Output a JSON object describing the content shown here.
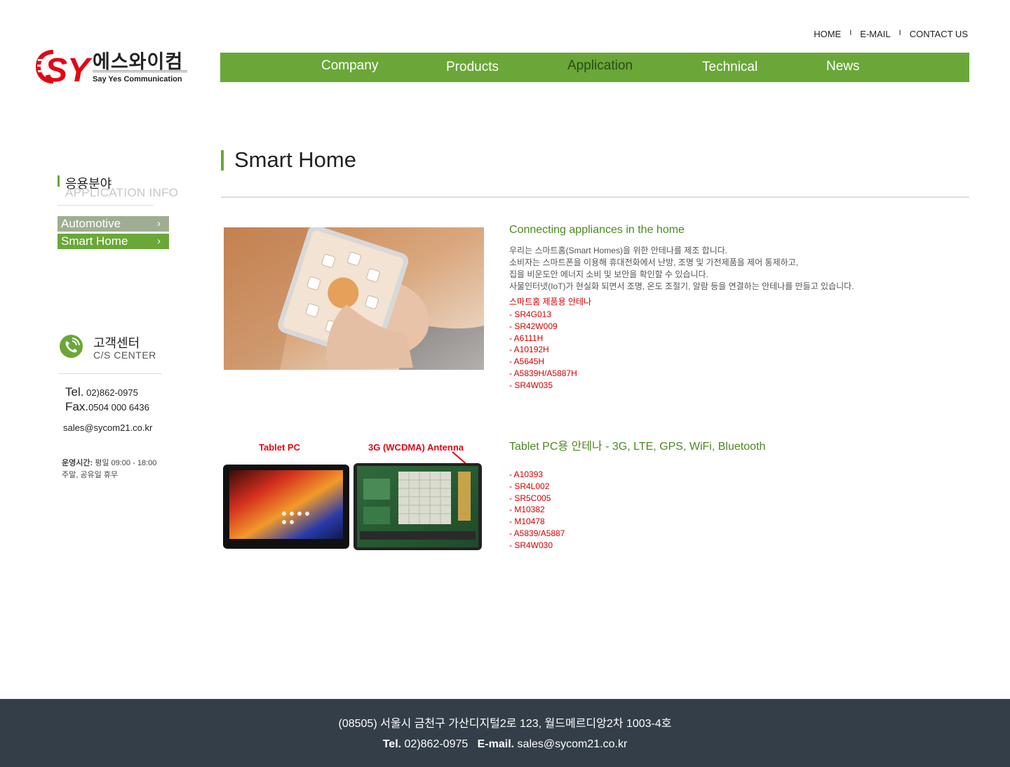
{
  "top_links": [
    "HOME",
    "E-MAIL",
    "CONTACT US"
  ],
  "top_link_separator": "I",
  "logo": {
    "mark": "SY",
    "name_ko": "에스와이컴",
    "name_en": "Say Yes Communication"
  },
  "nav": {
    "items": [
      "Company",
      "Products",
      "Application",
      "Technical",
      "News"
    ],
    "active": "Application"
  },
  "sidebar": {
    "title_ko": "응용분야",
    "title_en": "APPLICATION INFO",
    "menu": [
      {
        "label": "Automotive",
        "active": false
      },
      {
        "label": "Smart Home",
        "active": true
      }
    ],
    "cs_title_ko": "고객센터",
    "cs_title_en": "C/S CENTER",
    "tel_label": "Tel.",
    "tel": "02)862-0975",
    "fax_label": "Fax.",
    "fax": "0504 000 6436",
    "email": "sales@sycom21.co.kr",
    "hours_label": "운영시간:",
    "hours_weekday": "평일 09:00 - 18:00",
    "hours_closed": "주말, 공유일 휴무"
  },
  "main": {
    "page_title": "Smart Home",
    "section1": {
      "heading": "Connecting appliances in the home",
      "desc": [
        "우리는 스마트홈(Smart Homes)을 위한 안테나를 제조 합니다.",
        "소비자는 스마트폰을 이용해 휴대전화에서 난방, 조명 및 가전제품을 제어 통제하고,",
        "집을 비운도안 에너지 소비 및 보안을 확인할 수 있습니다.",
        "사물인터넷(IoT)가 현실화 되면서 조명, 온도 조절기, 알람 등을 연결하는 안테나를 만들고 있습니다."
      ],
      "products_heading": "스마트홈 제품용 안테나",
      "products": [
        "- SR4G013",
        "- SR42W009",
        "- A6111H",
        "- A10192H",
        "- A5645H",
        "- A5839H/A5887H",
        "- SR4W035"
      ]
    },
    "section2": {
      "heading": "Tablet PC용 안테나 - 3G, LTE, GPS, WiFi, Bluetooth",
      "image_label_left": "Tablet PC",
      "image_label_right": "3G (WCDMA) Antenna",
      "products": [
        "- A10393",
        "- SR4L002",
        "- SR5C005",
        "- M10382",
        "- M10478",
        "- A5839/A5887",
        "- SR4W030"
      ]
    }
  },
  "footer": {
    "address": "(08505) 서울시 금천구 가산디지털2로 123, 월드메르디앙2차 1003-4호",
    "tel_label": "Tel.",
    "tel": "02)862-0975",
    "email_label": "E-mail.",
    "email": "sales@sycom21.co.kr"
  },
  "colors": {
    "accent_green": "#6aa738",
    "heading_green": "#4b8a1e",
    "product_red": "#d40000",
    "footer_bg": "#333e48"
  }
}
